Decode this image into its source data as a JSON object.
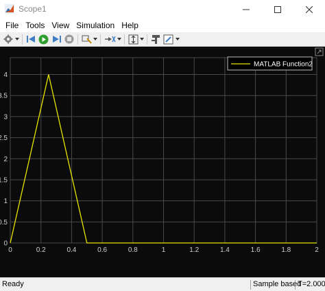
{
  "window": {
    "title": "Scope1"
  },
  "menu": [
    "File",
    "Tools",
    "View",
    "Simulation",
    "Help"
  ],
  "toolbar": {
    "icons": [
      "settings-icon",
      "dropdown-icon",
      "step-back-icon",
      "run-icon",
      "step-forward-icon",
      "stop-icon",
      "highlight-icon",
      "dropdown-icon",
      "signal-select-icon",
      "dropdown-icon",
      "zoom-fit-icon",
      "dropdown-icon",
      "style-icon",
      "properties-icon",
      "dropdown-icon"
    ]
  },
  "status": {
    "ready": "Ready",
    "mode": "Sample based",
    "time": "T=2.000"
  },
  "colors": {
    "plot_background": "#0b0b0b",
    "grid": "#4a4a4a",
    "signal": "#e6e600",
    "axis_text": "#cfcfcf"
  },
  "chart_data": {
    "type": "line",
    "legend_position": "top-right",
    "grid": true,
    "xlim": [
      0,
      2
    ],
    "ylim": [
      0,
      4.4
    ],
    "x_ticks": [
      "0",
      "0.2",
      "0.4",
      "0.6",
      "0.8",
      "1",
      "1.2",
      "1.4",
      "1.6",
      "1.8",
      "2"
    ],
    "x_tick_values": [
      0,
      0.2,
      0.4,
      0.6,
      0.8,
      1,
      1.2,
      1.4,
      1.6,
      1.8,
      2
    ],
    "y_ticks": [
      "0",
      "0.5",
      "1",
      "1.5",
      "2",
      "2.5",
      "3",
      "3.5",
      "4"
    ],
    "y_tick_values": [
      0,
      0.5,
      1,
      1.5,
      2,
      2.5,
      3,
      3.5,
      4
    ],
    "series": [
      {
        "name": "MATLAB Function2",
        "x": [
          0,
          0.25,
          0.5,
          2
        ],
        "y": [
          0,
          4,
          0,
          0
        ]
      }
    ]
  }
}
